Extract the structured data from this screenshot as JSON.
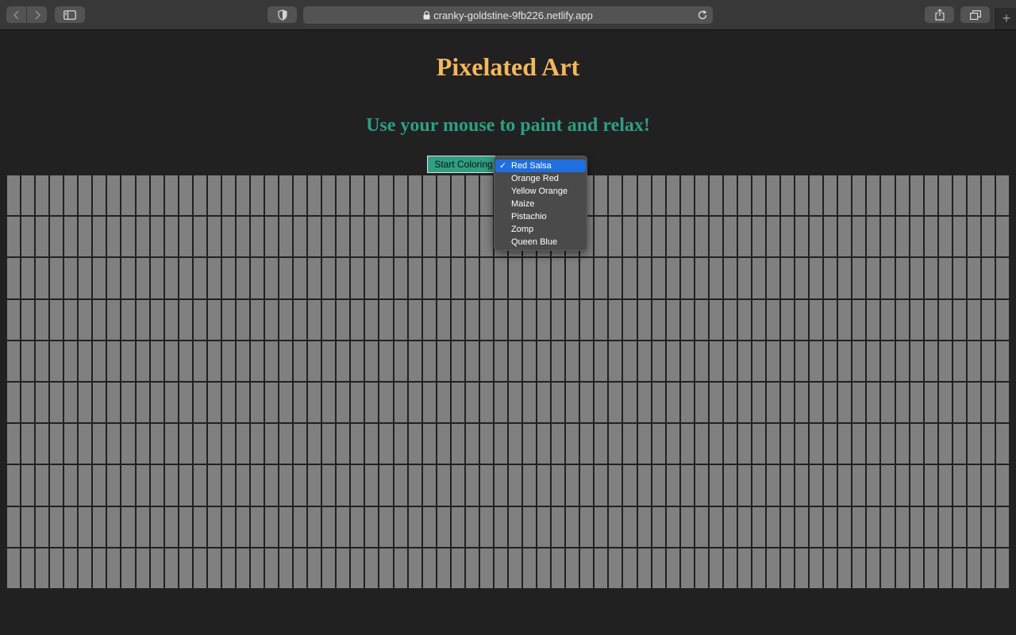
{
  "browser": {
    "url": "cranky-goldstine-9fb226.netlify.app",
    "new_tab_symbol": "+"
  },
  "page": {
    "title": "Pixelated Art",
    "subtitle": "Use your mouse to paint and relax!",
    "start_button_label": "Start Coloring",
    "colors": {
      "background": "#212121",
      "title": "#f3b75e",
      "subtitle": "#2e9f83",
      "cell": "#808080",
      "accent": "#1f6fde"
    }
  },
  "color_menu": {
    "selected_check": "✓",
    "options": [
      "Red Salsa",
      "Orange Red",
      "Yellow Orange",
      "Maize",
      "Pistachio",
      "Zomp",
      "Queen Blue"
    ]
  },
  "grid": {
    "rows": 10,
    "columns": 70
  }
}
